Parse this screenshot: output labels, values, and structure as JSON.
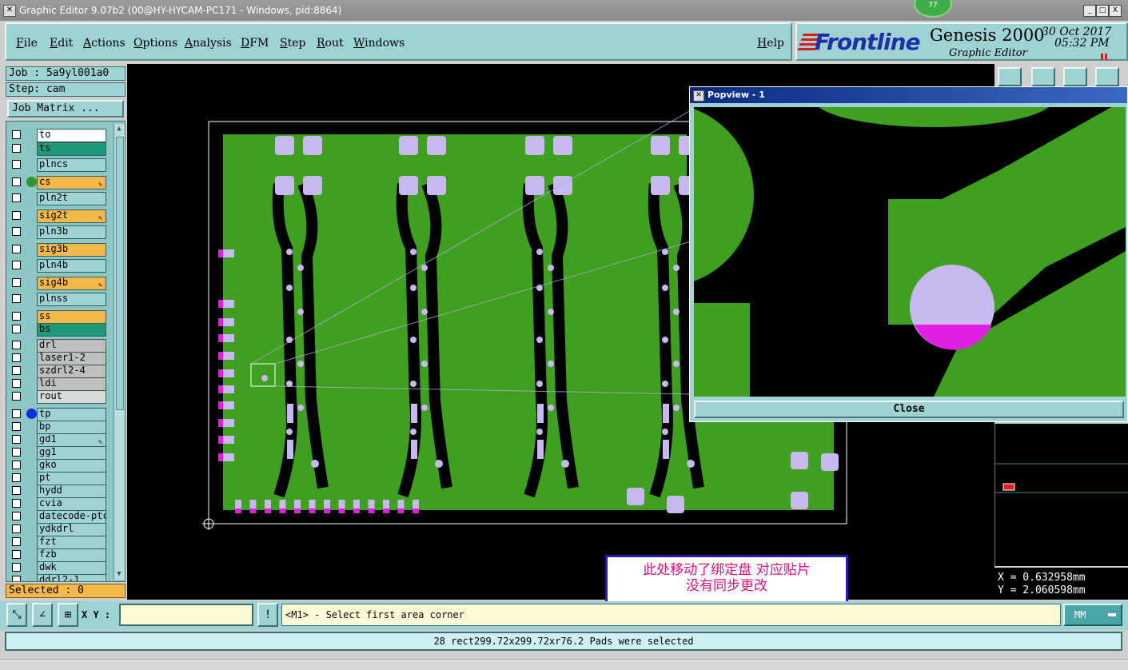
{
  "window": {
    "title": "Graphic Editor 9.07b2 (00@HY-HYCAM-PC171 - Windows, pid:8864)",
    "badge": "77",
    "controls": [
      "_",
      "□",
      "X"
    ]
  },
  "menu": [
    "File",
    "Edit",
    "Actions",
    "Options",
    "Analysis",
    "DFM",
    "Step",
    "Rout",
    "Windows"
  ],
  "help": "Help",
  "brand": {
    "logo": "Frontline",
    "product": "Genesis 2000",
    "subtitle": "Graphic Editor",
    "date": "30 Oct 2017",
    "time": "05:32 PM"
  },
  "job": {
    "job_label": "Job : 5a9yl001a0",
    "step_label": "Step: cam",
    "matrix_button": "Job Matrix ..."
  },
  "layers": [
    {
      "name": "to",
      "color": "#ffffff",
      "dot": ""
    },
    {
      "name": "ts",
      "color": "#1e9a78",
      "dot": ""
    },
    {
      "name": "plncs",
      "color": "#9fd3d3",
      "dot": ""
    },
    {
      "name": "cs",
      "color": "#f5b84a",
      "dot": "#2a9a2a",
      "edit": true
    },
    {
      "name": "pln2t",
      "color": "#9fd3d3",
      "dot": ""
    },
    {
      "name": "sig2t",
      "color": "#f5b84a",
      "dot": "",
      "edit": true
    },
    {
      "name": "pln3b",
      "color": "#9fd3d3",
      "dot": ""
    },
    {
      "name": "sig3b",
      "color": "#f5b84a",
      "dot": ""
    },
    {
      "name": "pln4b",
      "color": "#9fd3d3",
      "dot": ""
    },
    {
      "name": "sig4b",
      "color": "#f5b84a",
      "dot": "",
      "edit": true
    },
    {
      "name": "plnss",
      "color": "#9fd3d3",
      "dot": ""
    },
    {
      "name": "ss",
      "color": "#f5b84a",
      "dot": ""
    },
    {
      "name": "bs",
      "color": "#1e9a78",
      "dot": ""
    },
    {
      "name": "drl",
      "color": "#bfbfbf",
      "dot": ""
    },
    {
      "name": "laser1-2",
      "color": "#bfbfbf",
      "dot": ""
    },
    {
      "name": "szdrl2-4",
      "color": "#bfbfbf",
      "dot": ""
    },
    {
      "name": "ldi",
      "color": "#bfbfbf",
      "dot": ""
    },
    {
      "name": "rout",
      "color": "#d9d9d9",
      "dot": ""
    },
    {
      "name": "tp",
      "color": "#9fd3d3",
      "dot": "#1030e0"
    },
    {
      "name": "bp",
      "color": "#9fd3d3",
      "dot": ""
    },
    {
      "name": "gd1",
      "color": "#9fd3d3",
      "dot": "",
      "edit": true
    },
    {
      "name": "gg1",
      "color": "#9fd3d3",
      "dot": ""
    },
    {
      "name": "gko",
      "color": "#9fd3d3",
      "dot": ""
    },
    {
      "name": "pt",
      "color": "#9fd3d3",
      "dot": ""
    },
    {
      "name": "hydd",
      "color": "#9fd3d3",
      "dot": ""
    },
    {
      "name": "cvia",
      "color": "#9fd3d3",
      "dot": ""
    },
    {
      "name": "datecode-ptc",
      "color": "#9fd3d3",
      "dot": ""
    },
    {
      "name": "ydkdrl",
      "color": "#9fd3d3",
      "dot": ""
    },
    {
      "name": "fzt",
      "color": "#9fd3d3",
      "dot": ""
    },
    {
      "name": "fzb",
      "color": "#9fd3d3",
      "dot": ""
    },
    {
      "name": "dwk",
      "color": "#9fd3d3",
      "dot": ""
    },
    {
      "name": "ddrl2-1",
      "color": "#9fd3d3",
      "dot": ""
    }
  ],
  "selected": "Selected : 0",
  "popview": {
    "title": "Popview - 1",
    "close": "Close"
  },
  "coords": {
    "x": "X = 0.632958mm",
    "y": "Y = 2.060598mm"
  },
  "annotation": {
    "line1": "此处移动了绑定盘   对应贴片",
    "line2": "没有同步更改"
  },
  "bottom": {
    "xy_label": "X Y :",
    "xy_value": "",
    "bang": "!",
    "prompt": "<M1> - Select first area corner",
    "units": "MM",
    "status": "28 rect299.72x299.72xr76.2 Pads were selected"
  },
  "colors": {
    "panel": "#9fd3d3",
    "copper": "#3fa01f",
    "pad": "#c8b8f0",
    "selected_pad": "#e020e0"
  }
}
